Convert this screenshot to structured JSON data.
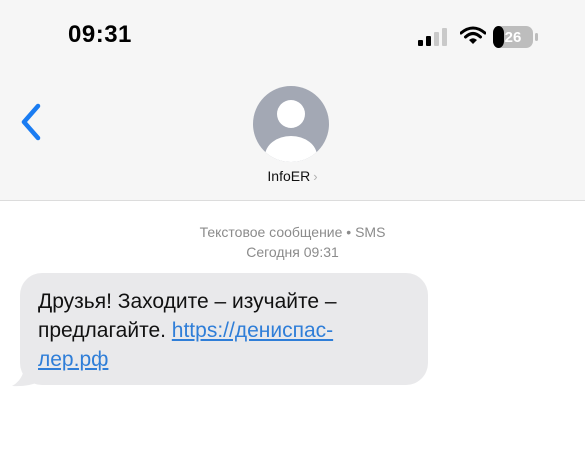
{
  "status_bar": {
    "time": "09:31",
    "battery_level": "26",
    "icons": [
      "signal-icon",
      "wifi-icon",
      "battery-icon"
    ]
  },
  "header": {
    "back_icon": "chevron-left-icon",
    "contact_name": "InfoER",
    "chevron": "›"
  },
  "conversation": {
    "message_type": "Текстовое сообщение • SMS",
    "timestamp": "Сегодня 09:31"
  },
  "message": {
    "line1": "Друзья! Заходите – изучайте –",
    "line2_text": "предлагайте. ",
    "line2_link": "https://дениспас-",
    "line3_link": "лер.рф"
  },
  "colors": {
    "link": "#2f7ed8",
    "back_button": "#1a7cf2",
    "bubble": "#e9e9eb",
    "header_bg": "#f6f6f6"
  }
}
